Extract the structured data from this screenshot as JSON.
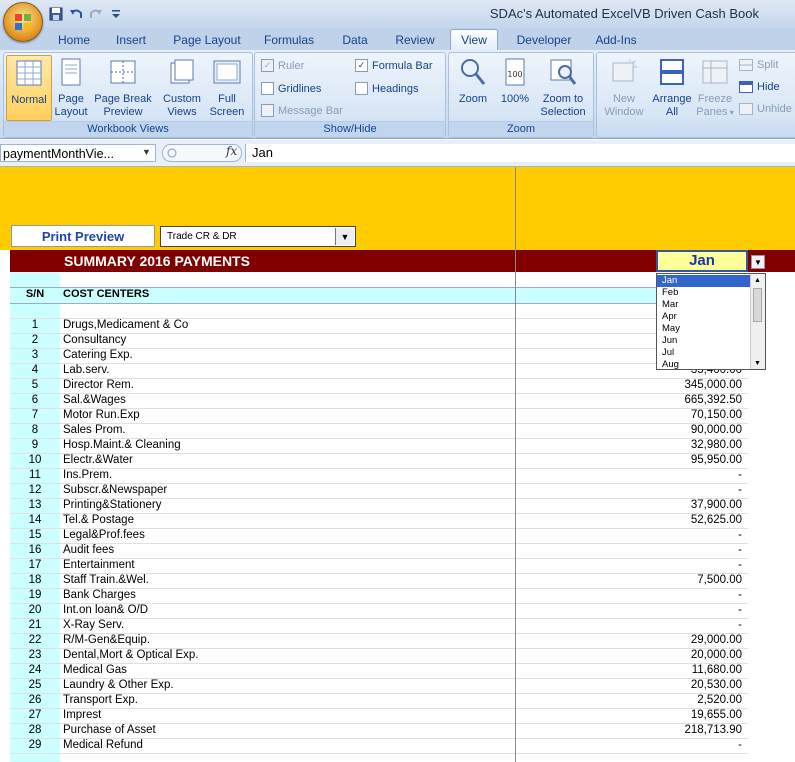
{
  "window": {
    "title": "SDAc's Automated ExcelVB Driven Cash Book"
  },
  "qat": {
    "icons": [
      "save-icon",
      "undo-icon",
      "redo-icon",
      "customize-icon"
    ]
  },
  "tabs": [
    "Home",
    "Insert",
    "Page Layout",
    "Formulas",
    "Data",
    "Review",
    "View",
    "Developer",
    "Add-Ins"
  ],
  "active_tab": "View",
  "ribbon": {
    "workbook_views": {
      "label": "Workbook Views",
      "normal": "Normal",
      "page_layout_1": "Page",
      "page_layout_2": "Layout",
      "page_break_1": "Page Break",
      "page_break_2": "Preview",
      "custom_views_1": "Custom",
      "custom_views_2": "Views",
      "full_screen_1": "Full",
      "full_screen_2": "Screen"
    },
    "show_hide": {
      "label": "Show/Hide",
      "ruler": "Ruler",
      "formula_bar": "Formula Bar",
      "gridlines": "Gridlines",
      "headings": "Headings",
      "message_bar": "Message Bar"
    },
    "zoom": {
      "label": "Zoom",
      "zoom": "Zoom",
      "zoom_100": "100%",
      "zoom_sel_1": "Zoom to",
      "zoom_sel_2": "Selection"
    },
    "window": {
      "new_window_1": "New",
      "new_window_2": "Window",
      "arrange_1": "Arrange",
      "arrange_2": "All",
      "freeze_1": "Freeze",
      "freeze_2": "Panes",
      "split": "Split",
      "hide": "Hide",
      "unhide": "Unhide"
    }
  },
  "formula_bar": {
    "name_box": "paymentMonthVie...",
    "fx": "fx",
    "value": "Jan"
  },
  "sheet": {
    "print_preview": "Print Preview",
    "combo_value": "Trade CR & DR",
    "summary_title": "SUMMARY 2016 PAYMENTS",
    "month": "Jan",
    "header_sn": "S/N",
    "header_cc": "COST CENTERS",
    "rows": [
      {
        "sn": "1",
        "cc": "Drugs,Medicament & Co",
        "amt": ""
      },
      {
        "sn": "2",
        "cc": "Consultancy",
        "amt": ""
      },
      {
        "sn": "3",
        "cc": "Catering Exp.",
        "amt": ""
      },
      {
        "sn": "4",
        "cc": "Lab.serv.",
        "amt": "35,400.00"
      },
      {
        "sn": "5",
        "cc": "Director Rem.",
        "amt": "345,000.00"
      },
      {
        "sn": "6",
        "cc": "Sal.&Wages",
        "amt": "665,392.50"
      },
      {
        "sn": "7",
        "cc": "Motor Run.Exp",
        "amt": "70,150.00"
      },
      {
        "sn": "8",
        "cc": "Sales Prom.",
        "amt": "90,000.00"
      },
      {
        "sn": "9",
        "cc": "Hosp.Maint.& Cleaning",
        "amt": "32,980.00"
      },
      {
        "sn": "10",
        "cc": "Electr.&Water",
        "amt": "95,950.00"
      },
      {
        "sn": "11",
        "cc": "Ins.Prem.",
        "amt": "-"
      },
      {
        "sn": "12",
        "cc": "Subscr.&Newspaper",
        "amt": "-"
      },
      {
        "sn": "13",
        "cc": "Printing&Stationery",
        "amt": "37,900.00"
      },
      {
        "sn": "14",
        "cc": "Tel.& Postage",
        "amt": "52,625.00"
      },
      {
        "sn": "15",
        "cc": "Legal&Prof.fees",
        "amt": "-"
      },
      {
        "sn": "16",
        "cc": "Audit fees",
        "amt": "-"
      },
      {
        "sn": "17",
        "cc": "Entertainment",
        "amt": "-"
      },
      {
        "sn": "18",
        "cc": "Staff Train.&Wel.",
        "amt": "7,500.00"
      },
      {
        "sn": "19",
        "cc": "Bank Charges",
        "amt": "-"
      },
      {
        "sn": "20",
        "cc": "Int.on loan& O/D",
        "amt": "-"
      },
      {
        "sn": "21",
        "cc": "X-Ray Serv.",
        "amt": "-"
      },
      {
        "sn": "22",
        "cc": "R/M-Gen&Equip.",
        "amt": "29,000.00"
      },
      {
        "sn": "23",
        "cc": "Dental,Mort & Optical Exp.",
        "amt": "20,000.00"
      },
      {
        "sn": "24",
        "cc": "Medical Gas",
        "amt": "11,680.00"
      },
      {
        "sn": "25",
        "cc": "Laundry & Other Exp.",
        "amt": "20,530.00"
      },
      {
        "sn": "26",
        "cc": "Transport Exp.",
        "amt": "2,520.00"
      },
      {
        "sn": "27",
        "cc": "Imprest",
        "amt": "19,655.00"
      },
      {
        "sn": "28",
        "cc": "Purchase of Asset",
        "amt": "218,713.90"
      },
      {
        "sn": "29",
        "cc": "Medical Refund",
        "amt": "-"
      }
    ]
  },
  "dropdown": {
    "items": [
      "Jan",
      "Feb",
      "Mar",
      "Apr",
      "May",
      "Jun",
      "Jul",
      "Aug"
    ],
    "selected": "Jan"
  }
}
